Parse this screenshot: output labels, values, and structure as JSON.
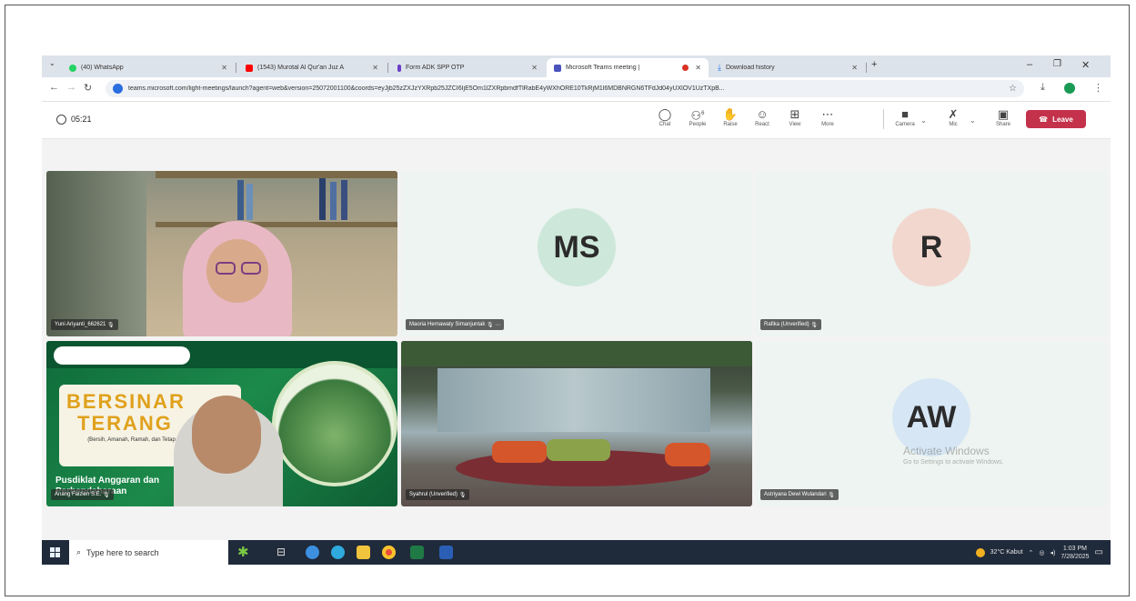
{
  "browser": {
    "tabs": [
      {
        "title": "(40) WhatsApp",
        "color": "#25d366"
      },
      {
        "title": "(1543) Murotal Al Qur'an Juz A",
        "color": "#ff0000"
      },
      {
        "title": "Form ADK SPP OTP",
        "color": "#6a3fc8"
      },
      {
        "title": "Microsoft Teams meeting |",
        "color": "#4b53bc",
        "active": true
      },
      {
        "title": "Download history",
        "color": "#1a73e8"
      }
    ],
    "new_tab": "+",
    "address": {
      "url": "teams.microsoft.com/light-meetings/launch?agent=web&version=25072001100&coords=eyJjb25zZXJzYXRpb25JZCI6IjE5Om1lZXRpbmdfTlRabE4yWXhORE10TkRjM1l6MDBNRGN6TFdJd04yUXlOV1UzTXpB..."
    }
  },
  "teams": {
    "timer": "05:21",
    "controls": [
      {
        "label": "Chat",
        "icon": "chat-icon"
      },
      {
        "label": "People",
        "icon": "people-icon",
        "badge": "6"
      },
      {
        "label": "Raise",
        "icon": "raise-hand-icon"
      },
      {
        "label": "React",
        "icon": "react-icon"
      },
      {
        "label": "View",
        "icon": "view-icon"
      },
      {
        "label": "More",
        "icon": "more-icon"
      },
      {
        "label": "Camera",
        "icon": "camera-icon"
      },
      {
        "label": "Mic",
        "icon": "mic-icon"
      },
      {
        "label": "Share",
        "icon": "share-icon"
      }
    ],
    "leave_label": "Leave",
    "leave_color": "#c4314b"
  },
  "participants": [
    {
      "name": "Yuni Ariyanti_662621",
      "initials": "",
      "video": true
    },
    {
      "name": "Maoria Hernawaty Simanjuntak",
      "initials": "MS",
      "avatar_color": "#cde8da",
      "video": false
    },
    {
      "name": "Rafika (Unverified)",
      "initials": "R",
      "avatar_color": "#f2d7cf",
      "video": false
    },
    {
      "name": "Anang Faizien S.E.",
      "initials": "",
      "video": true
    },
    {
      "name": "Syahrul (Unverified)",
      "initials": "",
      "video": true
    },
    {
      "name": "Astriyana Dewi Wulandari",
      "initials": "AW",
      "avatar_color": "#d6e6f4",
      "video": false
    }
  ],
  "banner": {
    "line1": "BERSINAR",
    "line2": "TERANG",
    "tagline": "(Bersih, Amanah, Ramah, dan Tetap Cemerlang)",
    "footer1": "Pusdiklat Anggaran dan",
    "footer2": "Perbendaharaan"
  },
  "watermark": {
    "title": "Activate Windows",
    "subtitle": "Go to Settings to activate Windows."
  },
  "taskbar": {
    "search_placeholder": "Type here to search",
    "weather": "32°C Kabut",
    "time": "1:03 PM",
    "date": "7/28/2025"
  }
}
